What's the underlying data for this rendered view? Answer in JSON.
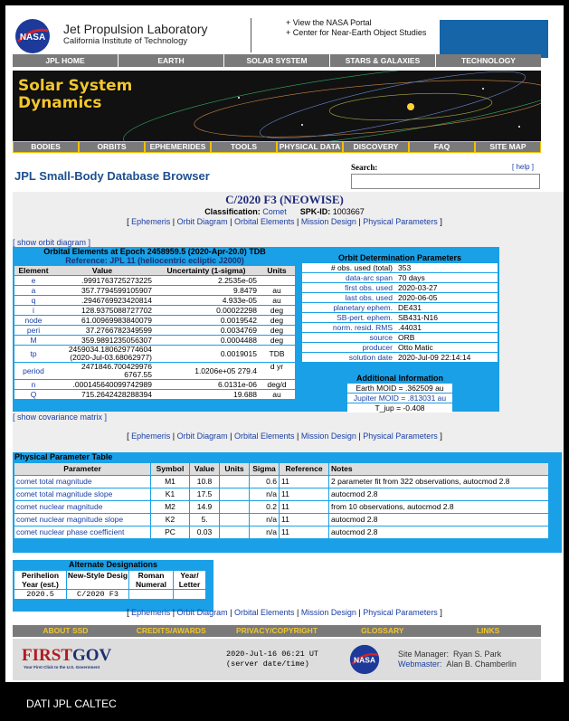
{
  "header": {
    "lab_title": "Jet Propulsion Laboratory",
    "lab_subtitle": "California Institute of Technology",
    "link1": "+ View the NASA Portal",
    "link2": "+ Center for Near-Earth Object Studies",
    "nasa_logo": "NASA"
  },
  "top_nav": [
    "JPL HOME",
    "EARTH",
    "SOLAR SYSTEM",
    "STARS & GALAXIES",
    "TECHNOLOGY"
  ],
  "banner": {
    "title_line1": "Solar System",
    "title_line2": "Dynamics"
  },
  "section_nav": [
    "BODIES",
    "ORBITS",
    "EPHEMERIDES",
    "TOOLS",
    "PHYSICAL DATA",
    "DISCOVERY",
    "FAQ",
    "SITE MAP"
  ],
  "page_title": "JPL Small-Body Database Browser",
  "search": {
    "label": "Search:",
    "help": "[ help ]",
    "value": ""
  },
  "object": {
    "name": "C/2020 F3 (NEOWISE)",
    "classification_label": "Classification:",
    "classification": "Comet",
    "spk_label": "SPK-ID:",
    "spk": "1003667"
  },
  "nav_links": {
    "open": "[",
    "ephemeris": "Ephemeris",
    "orbit_diagram": "Orbit Diagram",
    "orbital_elements": "Orbital Elements",
    "mission_design": "Mission Design",
    "physical_parameters": "Physical Parameters",
    "close": "]",
    "sep": "|"
  },
  "show_orbit_diagram": "[ show orbit diagram ]",
  "show_covariance": "[ show covariance matrix ]",
  "orbital_elements": {
    "title": "Orbital Elements at Epoch 2458959.5 (2020-Apr-20.0) TDB",
    "reference": "Reference: JPL 11 (heliocentric ecliptic J2000)",
    "headers": [
      "Element",
      "Value",
      "Uncertainty (1-sigma)",
      "Units"
    ],
    "rows": [
      {
        "el": "e",
        "val": ".9991763725273225",
        "unc": "2.2535e-05",
        "units": ""
      },
      {
        "el": "a",
        "val": "357.7794599105907",
        "unc": "9.8479",
        "units": "au"
      },
      {
        "el": "q",
        "val": ".2946769923420814",
        "unc": "4.933e-05",
        "units": "au"
      },
      {
        "el": "i",
        "val": "128.9375088727702",
        "unc": "0.00022298",
        "units": "deg"
      },
      {
        "el": "node",
        "val": "61.00969983840079",
        "unc": "0.0019542",
        "units": "deg"
      },
      {
        "el": "peri",
        "val": "37.2766782349599",
        "unc": "0.0034769",
        "units": "deg"
      },
      {
        "el": "M",
        "val": "359.9891235056307",
        "unc": "0.0004488",
        "units": "deg"
      },
      {
        "el": "tp",
        "val": "2459034.180629774604 (2020-Jul-03.68062977)",
        "unc": "0.0019015",
        "units": "TDB"
      },
      {
        "el": "period",
        "val": "2471846.700429976 6767.55",
        "unc": "1.0206e+05 279.4",
        "units": "d yr"
      },
      {
        "el": "n",
        "val": ".000145640099742989",
        "unc": "6.0131e-06",
        "units": "deg/d"
      },
      {
        "el": "Q",
        "val": "715.2642428288394",
        "unc": "19.688",
        "units": "au"
      }
    ]
  },
  "orbit_determination": {
    "title": "Orbit Determination Parameters",
    "rows": [
      {
        "k": "# obs. used (total)",
        "v": "353",
        "link": false
      },
      {
        "k": "data-arc span",
        "v": "70 days",
        "link": true
      },
      {
        "k": "first obs. used",
        "v": "2020-03-27",
        "link": true
      },
      {
        "k": "last obs. used",
        "v": "2020-06-05",
        "link": true
      },
      {
        "k": "planetary ephem.",
        "v": "DE431",
        "link": true
      },
      {
        "k": "SB-pert. ephem.",
        "v": "SB431-N16",
        "link": true
      },
      {
        "k": "norm. resid. RMS",
        "v": ".44031",
        "link": true
      },
      {
        "k": "source",
        "v": "ORB",
        "link": true
      },
      {
        "k": "producer",
        "v": "Otto Matic",
        "link": true
      },
      {
        "k": "solution date",
        "v": "2020-Jul-09 22:14:14",
        "link": true
      }
    ]
  },
  "additional": {
    "title": "Additional Information",
    "earth_moid": "Earth MOID = .362509 au",
    "jupiter_moid": "Jupiter MOID = .813031 au",
    "t_jup": "T_jup = -0.408"
  },
  "physical": {
    "title": "Physical Parameter Table",
    "headers": [
      "Parameter",
      "Symbol",
      "Value",
      "Units",
      "Sigma",
      "Reference",
      "Notes"
    ],
    "rows": [
      {
        "param": "comet total magnitude",
        "sym": "M1",
        "val": "10.8",
        "units": "",
        "sigma": "0.6",
        "ref": "11",
        "notes": "2 parameter fit from 322 observations, autocmod 2.8"
      },
      {
        "param": "comet total magnitude slope",
        "sym": "K1",
        "val": "17.5",
        "units": "",
        "sigma": "n/a",
        "ref": "11",
        "notes": "autocmod 2.8"
      },
      {
        "param": "comet nuclear magnitude",
        "sym": "M2",
        "val": "14.9",
        "units": "",
        "sigma": "0.2",
        "ref": "11",
        "notes": "from 10 observations, autocmod 2.8"
      },
      {
        "param": "comet nuclear magnitude slope",
        "sym": "K2",
        "val": "5.",
        "units": "",
        "sigma": "n/a",
        "ref": "11",
        "notes": "autocmod 2.8"
      },
      {
        "param": "comet nuclear phase coefficient",
        "sym": "PC",
        "val": "0.03",
        "units": "",
        "sigma": "n/a",
        "ref": "11",
        "notes": "autocmod 2.8"
      }
    ]
  },
  "alternate": {
    "title": "Alternate Designations",
    "h1": "Perihelion Year (est.)",
    "h2": "New-Style Desig",
    "h3": "Roman Numeral",
    "h4": "Year/ Letter",
    "v1": "2020.5",
    "v2": "C/2020 F3",
    "v3": "",
    "v4": ""
  },
  "footer_nav": [
    "ABOUT SSD",
    "CREDITS/AWARDS",
    "PRIVACY/COPYRIGHT",
    "GLOSSARY",
    "LINKS"
  ],
  "footer": {
    "firstgov_a": "FIRST",
    "firstgov_b": "GOV",
    "firstgov_tag": "Your First Click to the U.S. Government",
    "datetime": "2020-Jul-16 06:21 UT",
    "datetime_note": "(server date/time)",
    "site_manager_label": "Site Manager:",
    "site_manager": "Ryan S. Park",
    "webmaster_label": "Webmaster:",
    "webmaster": "Alan B. Chamberlin"
  },
  "caption": "DATI JPL CALTEC"
}
